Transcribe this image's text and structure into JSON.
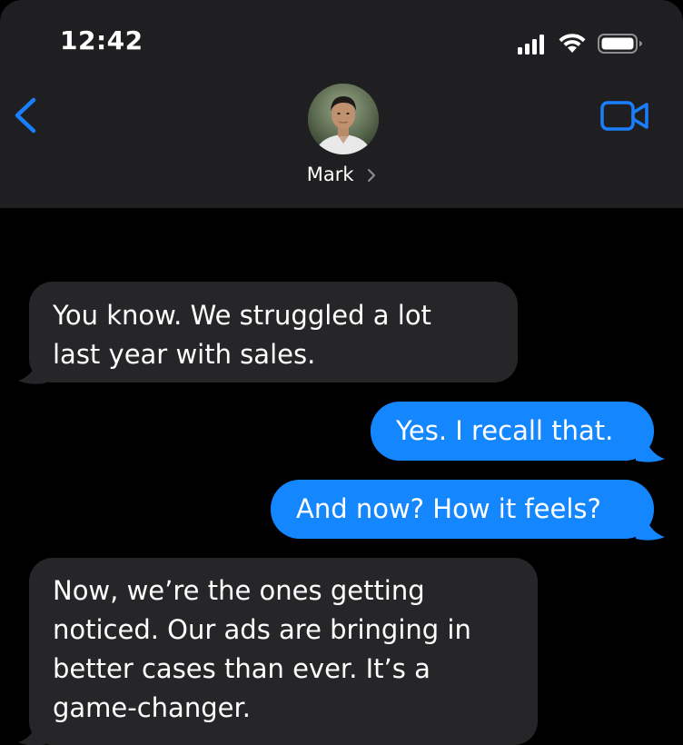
{
  "status_bar": {
    "time": "12:42",
    "icons": [
      "cellular-signal-icon",
      "wifi-icon",
      "battery-icon"
    ]
  },
  "nav": {
    "back_icon": "chevron-left-icon",
    "contact_name": "Mark",
    "video_icon": "video-camera-icon",
    "accent_color": "#1a7fff"
  },
  "messages": [
    {
      "direction": "incoming",
      "text": "You know. We struggled a lot\nlast year with sales."
    },
    {
      "direction": "outgoing",
      "text": "Yes. I recall that."
    },
    {
      "direction": "outgoing",
      "text": "And now? How it feels?"
    },
    {
      "direction": "incoming",
      "text": "Now, we’re the ones getting\nnoticed. Our ads are bringing in\nbetter cases than ever. It’s a\ngame-changer."
    }
  ],
  "colors": {
    "header_bg": "#1f1f21",
    "background": "#000000",
    "incoming_bubble": "#262628",
    "outgoing_bubble": "#1487ff"
  }
}
